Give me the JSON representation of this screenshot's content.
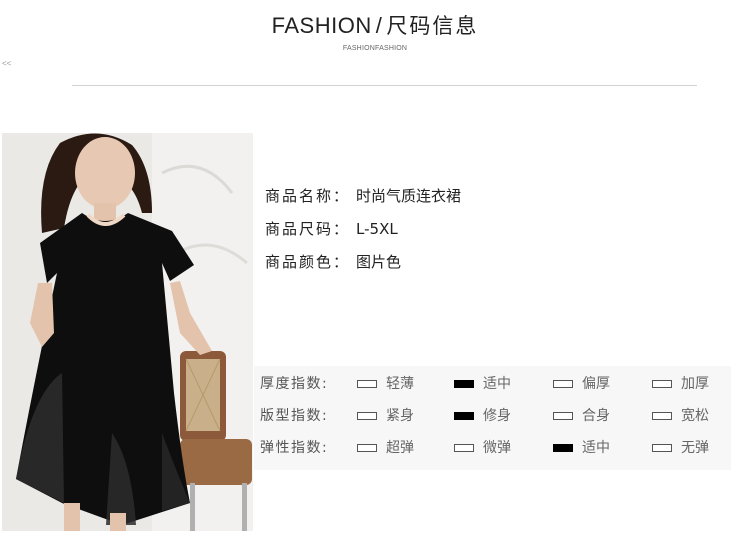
{
  "header": {
    "title_en": "FASHION",
    "title_sep": "/",
    "title_cn": "尺码信息",
    "subtitle": "FASHIONFASHION",
    "side_mark": "<<"
  },
  "photo": {
    "label": "model-photo"
  },
  "product": {
    "rows": [
      {
        "label": "商品名称：",
        "value": "时尚气质连衣裙"
      },
      {
        "label": "商品尺码：",
        "value": "L-5XL"
      },
      {
        "label": "商品颜色：",
        "value": "图片色"
      }
    ]
  },
  "ratings": [
    {
      "label": "厚度指数:",
      "options": [
        "轻薄",
        "适中",
        "偏厚",
        "加厚"
      ],
      "selected": 1
    },
    {
      "label": "版型指数:",
      "options": [
        "紧身",
        "修身",
        "合身",
        "宽松"
      ],
      "selected": 1
    },
    {
      "label": "弹性指数:",
      "options": [
        "超弹",
        "微弹",
        "适中",
        "无弹"
      ],
      "selected": 2
    }
  ],
  "colors": {
    "selected_box": "#000000",
    "panel_bg": "#f7f7f7",
    "divider": "#d3d3d3"
  }
}
